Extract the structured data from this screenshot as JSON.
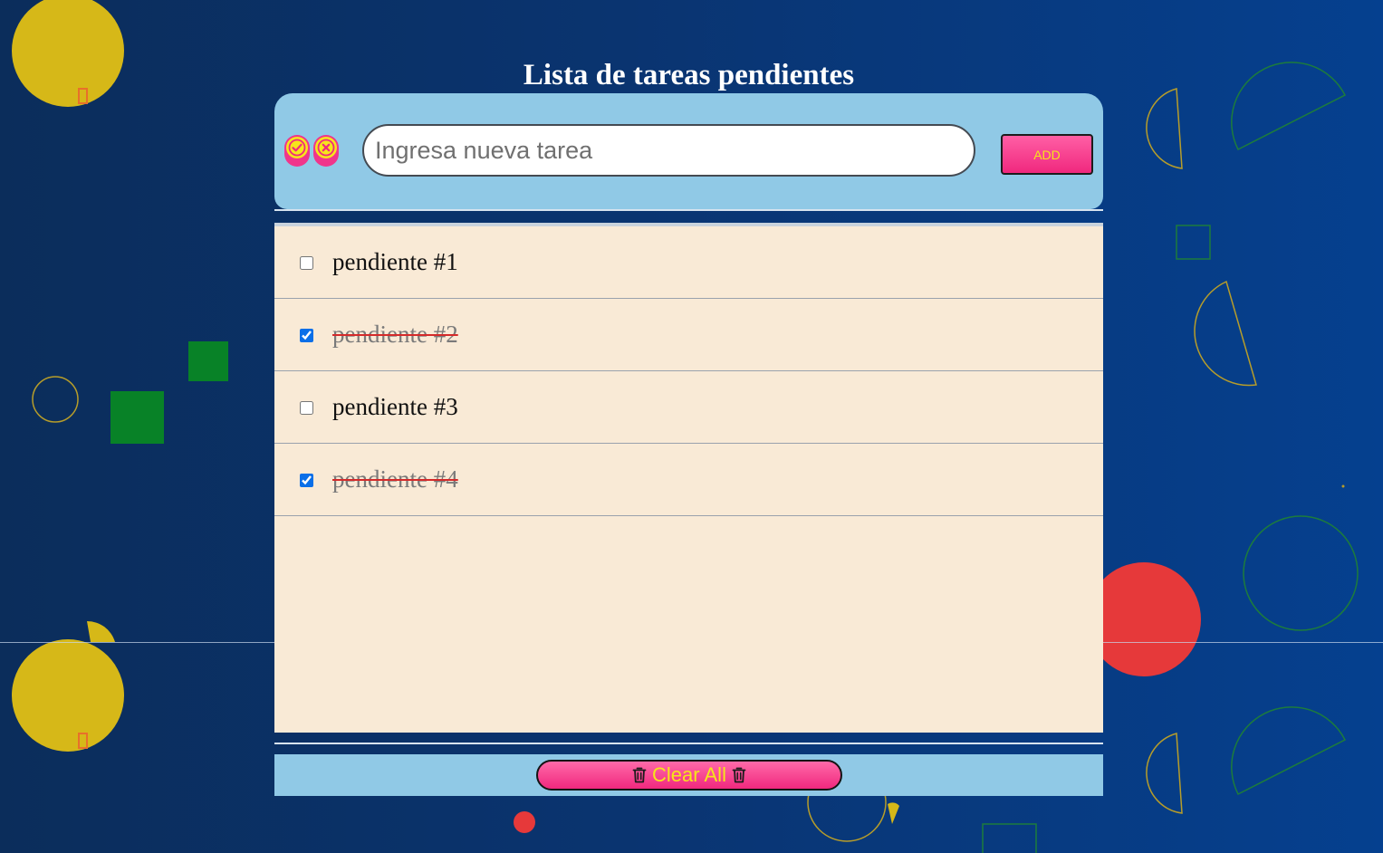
{
  "page": {
    "title": "Lista de tareas pendientes"
  },
  "toolbar": {
    "check_all_icon": "check-circle-icon",
    "uncheck_all_icon": "close-circle-icon",
    "input_placeholder": "Ingresa nueva tarea",
    "input_value": "",
    "add_label": "ADD"
  },
  "tasks": [
    {
      "label": "pendiente #1",
      "done": false
    },
    {
      "label": "pendiente #2",
      "done": true
    },
    {
      "label": "pendiente #3",
      "done": false
    },
    {
      "label": "pendiente #4",
      "done": true
    }
  ],
  "footer": {
    "clear_label": "Clear All",
    "clear_icon": "trash-icon"
  },
  "colors": {
    "background": "#0a3470",
    "panel": "#90c9e6",
    "list_background": "#f9ead6",
    "button_pink": "#f0287e",
    "button_text_yellow": "#f5e51a",
    "strike_red": "#d42a2a"
  }
}
